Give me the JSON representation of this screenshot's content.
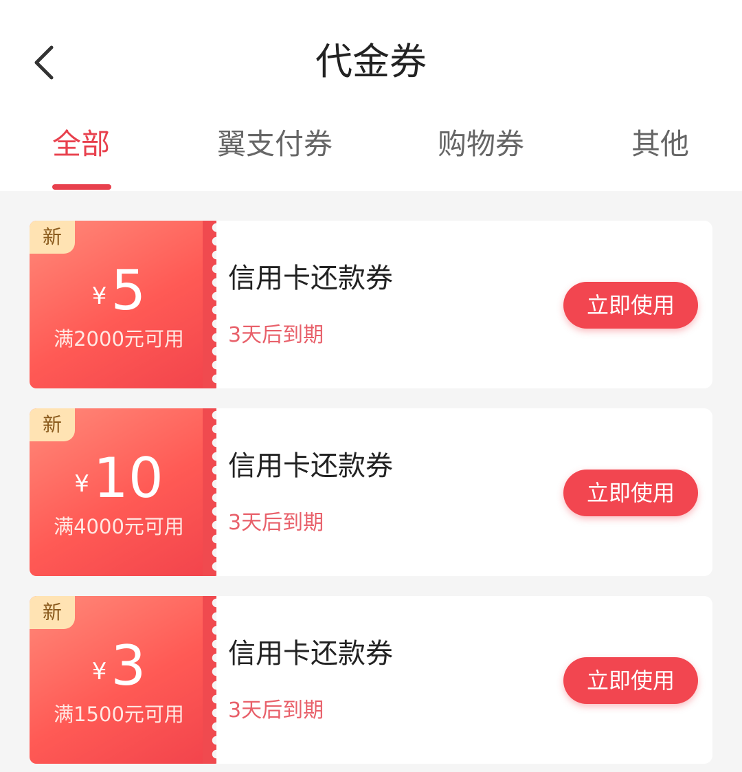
{
  "header": {
    "title": "代金券",
    "back_icon": "chevron-left-icon"
  },
  "tabs": [
    {
      "label": "全部",
      "active": true
    },
    {
      "label": "翼支付券",
      "active": false
    },
    {
      "label": "购物券",
      "active": false
    },
    {
      "label": "其他",
      "active": false
    }
  ],
  "colors": {
    "accent": "#e8404d",
    "coupon_gradient_start": "#ff8a7a",
    "coupon_gradient_end": "#f2444c",
    "badge_bg": "#ffe3b3"
  },
  "coupons": [
    {
      "badge": "新",
      "currency": "¥",
      "amount": "5",
      "condition": "满2000元可用",
      "name": "信用卡还款券",
      "expiry": "3天后到期",
      "button": "立即使用"
    },
    {
      "badge": "新",
      "currency": "¥",
      "amount": "10",
      "condition": "满4000元可用",
      "name": "信用卡还款券",
      "expiry": "3天后到期",
      "button": "立即使用"
    },
    {
      "badge": "新",
      "currency": "¥",
      "amount": "3",
      "condition": "满1500元可用",
      "name": "信用卡还款券",
      "expiry": "3天后到期",
      "button": "立即使用"
    }
  ]
}
